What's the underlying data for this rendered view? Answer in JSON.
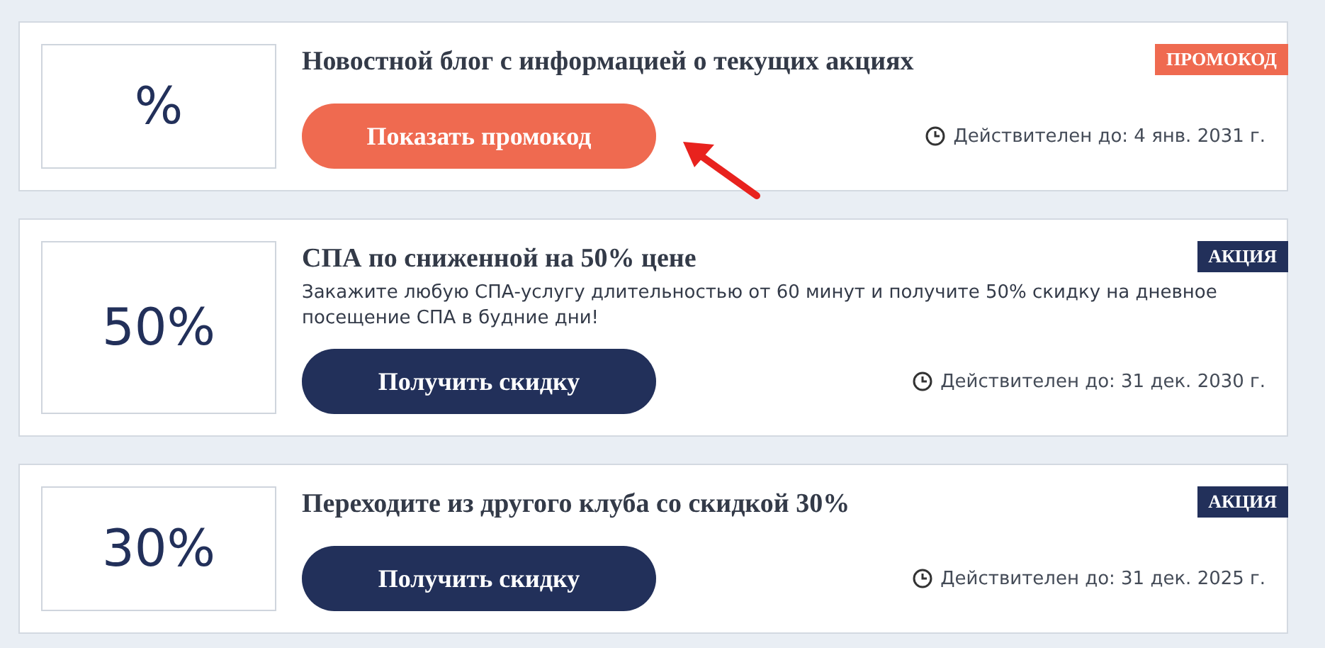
{
  "offers": [
    {
      "kind": "promocode",
      "value": "%",
      "title": "Новостной блог с информацией о текущих акциях",
      "tag": "ПРОМОКОД",
      "button": "Показать промокод",
      "valid": "Действителен до: 4 янв. 2031 г."
    },
    {
      "kind": "discount",
      "value": "50%",
      "title": "СПА по сниженной на 50% цене",
      "description": "Закажите любую СПА-услугу длительностью от 60 минут и получите 50% скидку на дневное посещение СПА в будние дни!",
      "tag": "АКЦИЯ",
      "button": "Получить скидку",
      "valid": "Действителен до: 31 дек. 2030 г."
    },
    {
      "kind": "discount",
      "value": "30%",
      "title": "Переходите из другого клуба со скидкой 30%",
      "tag": "АКЦИЯ",
      "button": "Получить скидку",
      "valid": "Действителен до: 31 дек. 2025 г."
    }
  ]
}
